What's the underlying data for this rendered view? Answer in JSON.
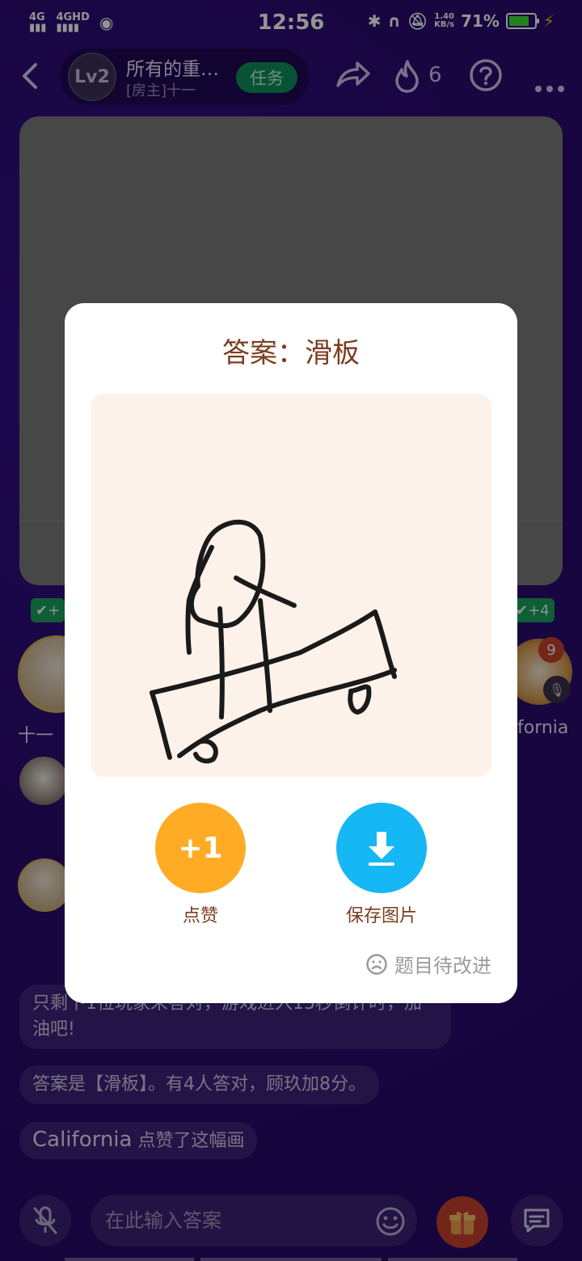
{
  "status_bar": {
    "net1": "4G",
    "net2": "4GHD",
    "time": "12:56",
    "speed_value": "1.40",
    "speed_unit": "KB/s",
    "battery": "71%"
  },
  "header": {
    "level": "Lv2",
    "room_title": "所有的重…",
    "room_sub": "[房主]十一",
    "task_label": "任务",
    "fire_count": "6"
  },
  "players": {
    "left_plus": "+",
    "left_name": "十一",
    "right_plus": "+4",
    "right_badge": "9",
    "right_name": "fornia"
  },
  "chat": {
    "messages": [
      {
        "text": "只剩下1位玩家未答对，游戏进入15秒倒计时，加油吧!"
      },
      {
        "text": "答案是【滑板】。有4人答对，顾玖加8分。"
      }
    ],
    "like_msg": {
      "name": "California",
      "text": "点赞了这幅画"
    }
  },
  "input_bar": {
    "placeholder": "在此输入答案"
  },
  "modal": {
    "title": "答案：滑板",
    "like_button": "+1",
    "like_label": "点赞",
    "save_label": "保存图片",
    "improve_label": "题目待改进"
  },
  "colors": {
    "background": "#2b0c73",
    "modal_title": "#7a3e1e",
    "like_button": "#ffac24",
    "save_button": "#15b7f5",
    "task_button": "#0e8e5e",
    "drawing_bg": "#fdf2ea"
  }
}
